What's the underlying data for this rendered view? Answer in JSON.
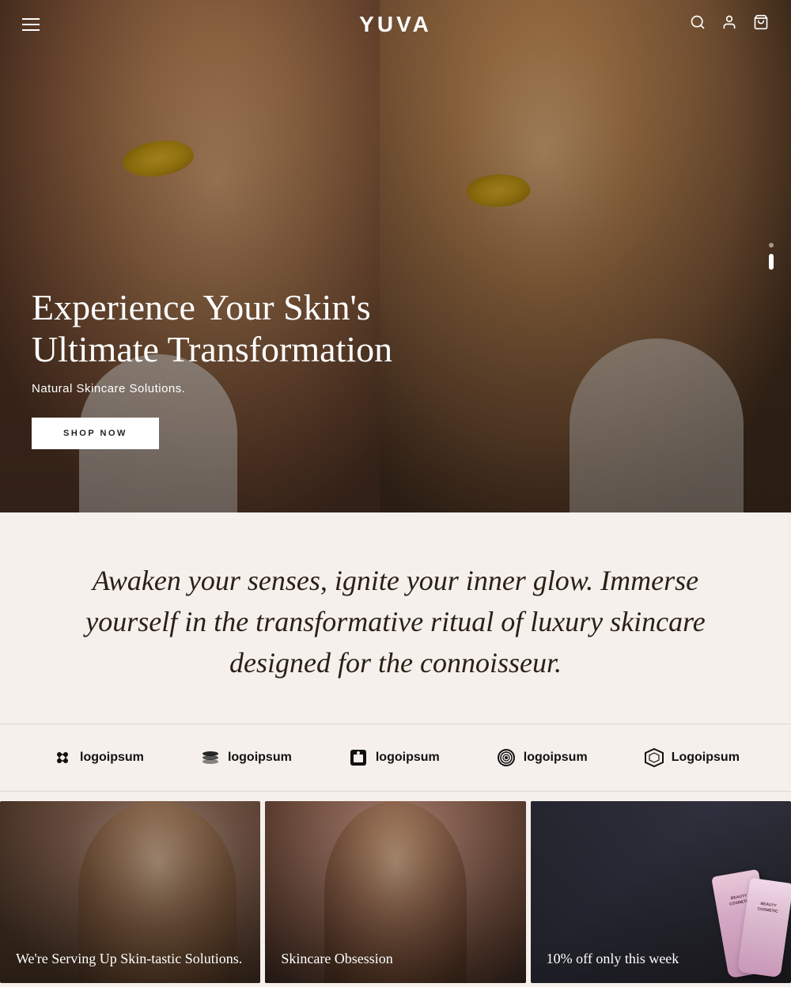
{
  "nav": {
    "logo": "YUVA",
    "hamburger_label": "menu",
    "search_label": "search",
    "account_label": "account",
    "cart_label": "cart"
  },
  "hero": {
    "title": "Experience Your Skin's Ultimate Transformation",
    "subtitle": "Natural Skincare Solutions.",
    "cta_label": "SHOP NOW",
    "scroll_dots": [
      {
        "active": false
      },
      {
        "active": true
      }
    ]
  },
  "tagline": {
    "text": "Awaken your senses, ignite your inner glow. Immerse yourself in the transformative ritual of luxury skincare designed for the connoisseur."
  },
  "brands": [
    {
      "name": "logoipsum",
      "icon": "✦"
    },
    {
      "name": "logoipsum",
      "icon": "≋"
    },
    {
      "name": "logoipsum",
      "icon": "⬛"
    },
    {
      "name": "logoipsum",
      "icon": "◎"
    },
    {
      "name": "Logoipsum",
      "icon": "⬡"
    }
  ],
  "cards": [
    {
      "title": "We're Serving Up Skin-tastic Solutions.",
      "type": "face1"
    },
    {
      "title": "Skincare Obsession",
      "type": "face2"
    },
    {
      "title": "10% off only this week",
      "type": "product"
    }
  ]
}
